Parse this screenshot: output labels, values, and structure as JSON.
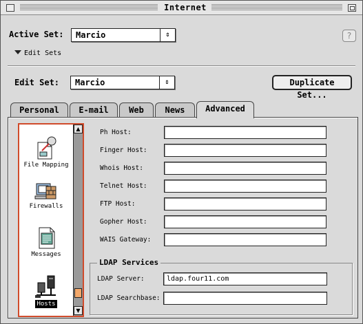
{
  "window": {
    "title": "Internet"
  },
  "header": {
    "active_set_label": "Active Set:",
    "active_set_value": "Marcio",
    "help_symbol": "?",
    "edit_sets_label": "Edit Sets",
    "edit_set_label": "Edit Set:",
    "edit_set_value": "Marcio",
    "duplicate_button": "Duplicate Set..."
  },
  "tabs": [
    {
      "label": "Personal"
    },
    {
      "label": "E-mail"
    },
    {
      "label": "Web"
    },
    {
      "label": "News"
    },
    {
      "label": "Advanced",
      "active": true
    }
  ],
  "sidebar": {
    "items": [
      {
        "label": "File Mapping",
        "icon": "file-mapping-icon"
      },
      {
        "label": "Firewalls",
        "icon": "firewalls-icon"
      },
      {
        "label": "Messages",
        "icon": "messages-icon"
      },
      {
        "label": "Hosts",
        "icon": "hosts-icon",
        "selected": true
      }
    ],
    "scroll_up": "▲",
    "scroll_down": "▼"
  },
  "hosts": {
    "fields": [
      {
        "label": "Ph Host:",
        "value": ""
      },
      {
        "label": "Finger Host:",
        "value": ""
      },
      {
        "label": "Whois Host:",
        "value": ""
      },
      {
        "label": "Telnet Host:",
        "value": ""
      },
      {
        "label": "FTP Host:",
        "value": ""
      },
      {
        "label": "Gopher Host:",
        "value": ""
      },
      {
        "label": "WAIS Gateway:",
        "value": ""
      }
    ],
    "ldap": {
      "title": "LDAP Services",
      "server_label": "LDAP Server:",
      "server_value": "ldap.four11.com",
      "searchbase_label": "LDAP Searchbase:",
      "searchbase_value": ""
    }
  },
  "colors": {
    "selection_frame": "#d04a2a",
    "scroll_thumb": "#f3a86a"
  }
}
